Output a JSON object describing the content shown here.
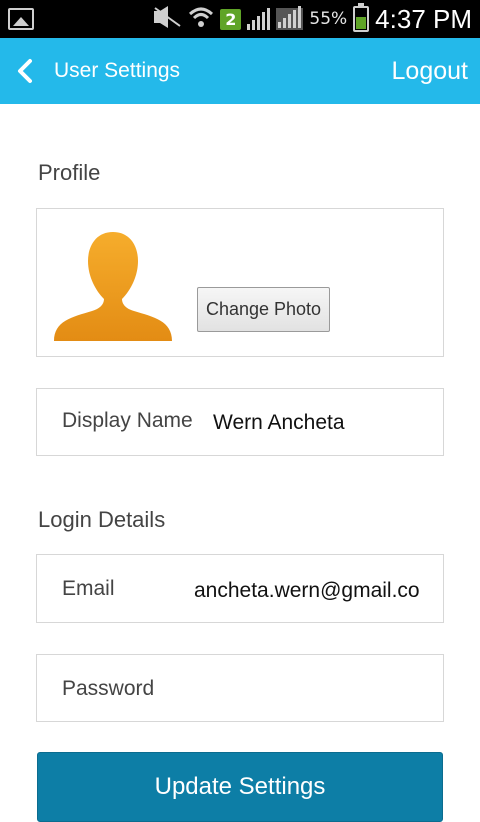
{
  "status_bar": {
    "battery_percent": "55%",
    "time": "4:37 PM",
    "notification_badge": "2",
    "icons": [
      "gallery-icon",
      "mute-icon",
      "wifi-icon",
      "signal-icon",
      "battery-icon"
    ]
  },
  "app_bar": {
    "title": "User Settings",
    "logout_label": "Logout",
    "background": "#24b9ea"
  },
  "profile": {
    "section_title": "Profile",
    "change_photo_label": "Change Photo",
    "avatar_color": "#f2a126"
  },
  "display_name": {
    "label": "Display Name",
    "value": "Wern Ancheta"
  },
  "login_details": {
    "section_title": "Login Details",
    "email_label": "Email",
    "email_value": "ancheta.wern@gmail.co",
    "password_label": "Password",
    "password_value": ""
  },
  "update_button": {
    "label": "Update Settings",
    "background": "#0d7ea6"
  }
}
